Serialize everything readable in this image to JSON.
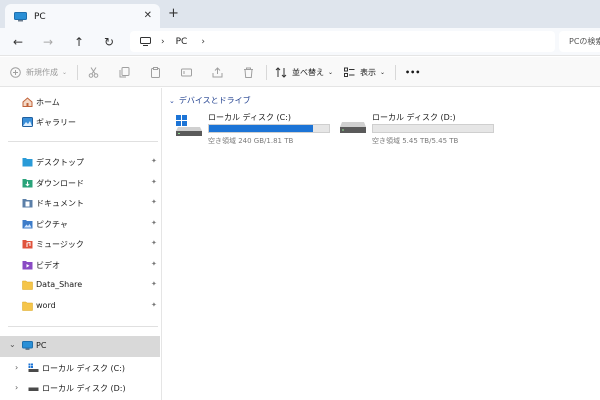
{
  "tab": {
    "title": "PC",
    "close": "✕",
    "new_tab": "+"
  },
  "nav": {
    "back": "←",
    "forward": "→",
    "up": "↑",
    "refresh": "↻"
  },
  "address": {
    "sep": "›",
    "segment": "PC",
    "trailing_sep": "›"
  },
  "search": {
    "placeholder": "PCの検索"
  },
  "commands": {
    "new": "新規作成",
    "sort": "並べ替え",
    "view": "表示",
    "more": "•••"
  },
  "sidebar": {
    "top": [
      {
        "label": "ホーム",
        "icon": "home-icon"
      },
      {
        "label": "ギャラリー",
        "icon": "gallery-icon"
      }
    ],
    "pinned": [
      {
        "label": "デスクトップ",
        "icon": "desktop-folder-icon",
        "pin": "📌"
      },
      {
        "label": "ダウンロード",
        "icon": "downloads-folder-icon",
        "pin": "📌"
      },
      {
        "label": "ドキュメント",
        "icon": "documents-folder-icon",
        "pin": "📌"
      },
      {
        "label": "ピクチャ",
        "icon": "pictures-folder-icon",
        "pin": "📌"
      },
      {
        "label": "ミュージック",
        "icon": "music-folder-icon",
        "pin": "📌"
      },
      {
        "label": "ビデオ",
        "icon": "videos-folder-icon",
        "pin": "📌"
      },
      {
        "label": "Data_Share",
        "icon": "folder-icon",
        "pin": "📌"
      },
      {
        "label": "word",
        "icon": "folder-icon",
        "pin": "📌"
      }
    ],
    "pc": {
      "label": "PC",
      "expander": "⌄"
    },
    "drives": [
      {
        "label": "ローカル ディスク (C:)",
        "expander": "›"
      },
      {
        "label": "ローカル ディスク (D:)",
        "expander": "›"
      }
    ]
  },
  "main": {
    "group_title": "デバイスとドライブ",
    "group_chevron": "⌄",
    "drives": [
      {
        "name": "ローカル ディスク (C:)",
        "info": "空き領域 240 GB/1.81 TB",
        "used_fraction": 0.87,
        "system": true
      },
      {
        "name": "ローカル ディスク (D:)",
        "info": "空き領域 5.45 TB/5.45 TB",
        "used_fraction": 0.0,
        "system": false
      }
    ]
  },
  "colors": {
    "accent": "#1c74d6",
    "tabbar": "#dfe5ed",
    "selected": "#d9d9d9"
  }
}
